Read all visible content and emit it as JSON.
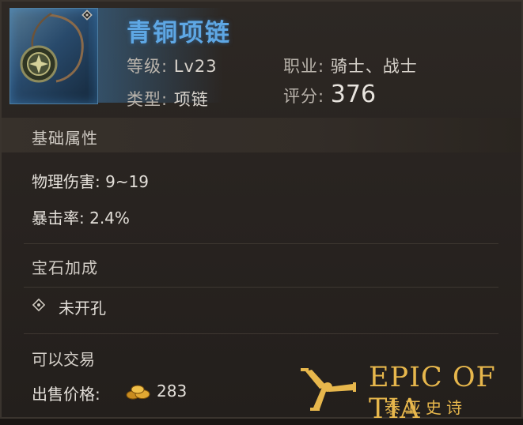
{
  "item": {
    "name": "青铜项链",
    "level_label": "等级:",
    "level_value": "Lv23",
    "class_label": "职业:",
    "class_value": "骑士、战士",
    "type_label": "类型:",
    "type_value": "项链",
    "score_label": "评分:",
    "score_value": "376"
  },
  "sections": {
    "base": {
      "title": "基础属性",
      "attrs": [
        "物理伤害: 9~19",
        "暴击率: 2.4%"
      ]
    },
    "gem": {
      "title": "宝石加成",
      "socket_status": "未开孔"
    }
  },
  "footer": {
    "tradable": "可以交易",
    "sell_label": "出售价格:",
    "sell_price": "283",
    "currency_icon": "gold-coins-icon"
  },
  "logo": {
    "title": "EPIC OF TIA",
    "subtitle": "泰亚史诗"
  },
  "colors": {
    "name": "#5ea7e4",
    "gold": "#e7b74c",
    "panel": "#282320"
  }
}
